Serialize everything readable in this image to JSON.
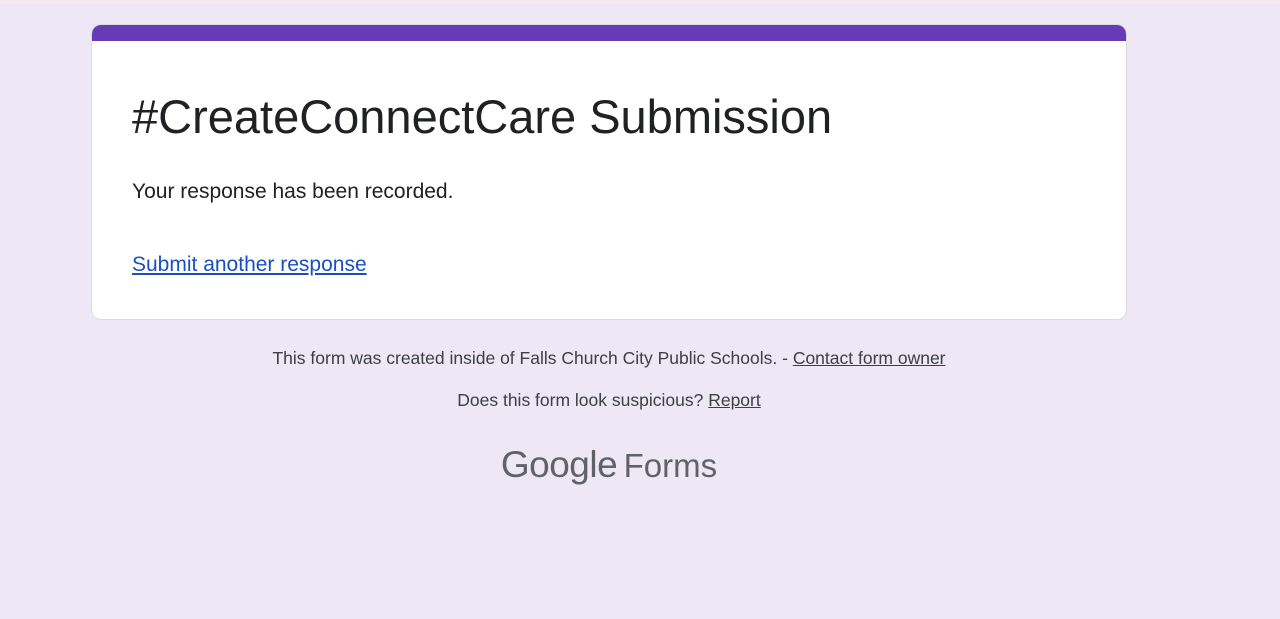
{
  "form": {
    "title": "#CreateConnectCare Submission",
    "confirmation_message": "Your response has been recorded.",
    "submit_another_label": "Submit another response"
  },
  "footer": {
    "created_inside_text": "This form was created inside of Falls Church City Public Schools. - ",
    "contact_owner_label": "Contact form owner",
    "suspicious_text": "Does this form look suspicious? ",
    "report_label": "Report"
  },
  "branding": {
    "google": "Google",
    "forms": "Forms"
  },
  "colors": {
    "background": "#ede7f6",
    "accent": "#673ab7",
    "link": "#1a4fc4"
  }
}
